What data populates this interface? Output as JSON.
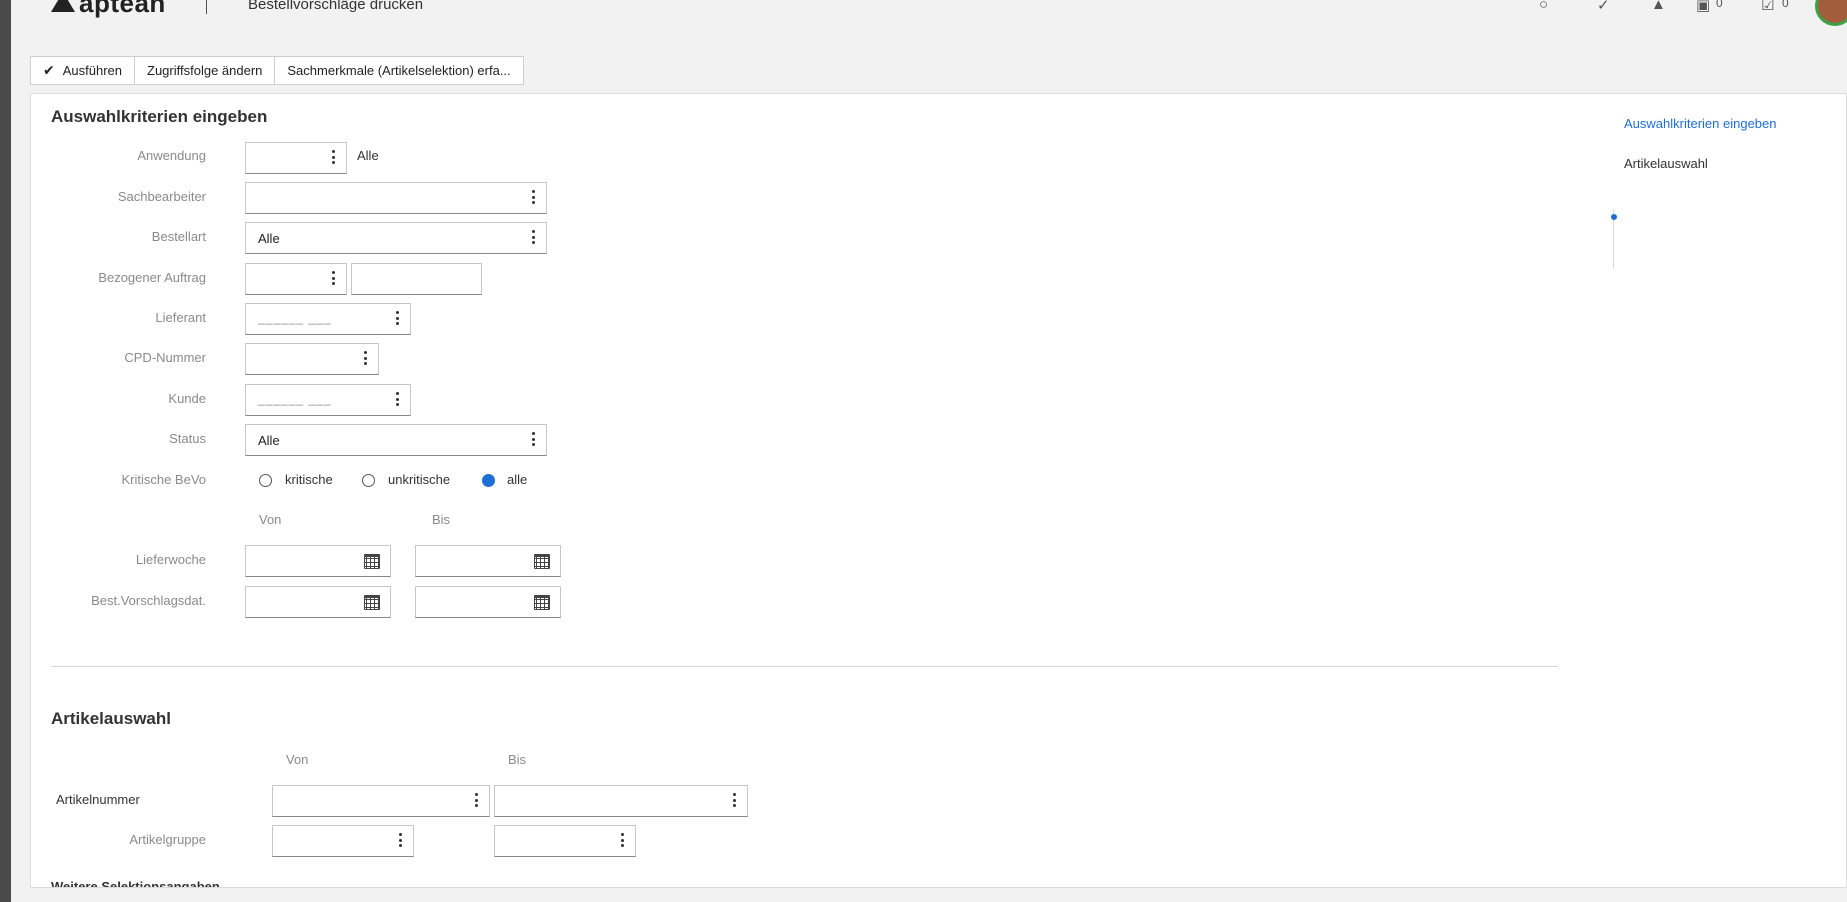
{
  "header": {
    "logo": "aptean",
    "page_title": "Bestellvorschläge drucken",
    "count_1": "0",
    "count_2": "0"
  },
  "toolbar": {
    "execute_label": "Ausführen",
    "change_sequence_label": "Zugriffsfolge ändern",
    "features_label": "Sachmerkmale (Artikelselektion) erfa..."
  },
  "section1": {
    "title": "Auswahlkriterien eingeben",
    "anwendung_label": "Anwendung",
    "anwendung_suffix": "Alle",
    "sachbearbeiter_label": "Sachbearbeiter",
    "bestellart_label": "Bestellart",
    "bestellart_value": "Alle",
    "bezogener_auftrag_label": "Bezogener Auftrag",
    "lieferant_label": "Lieferant",
    "lieferant_mask": "______ ___",
    "cpd_label": "CPD-Nummer",
    "kunde_label": "Kunde",
    "kunde_mask": "______ ___",
    "status_label": "Status",
    "status_value": "Alle",
    "kritische_label": "Kritische BeVo",
    "radio_kritische": "kritische",
    "radio_unkritische": "unkritische",
    "radio_alle": "alle",
    "von": "Von",
    "bis": "Bis",
    "lieferwoche_label": "Lieferwoche",
    "bestvorschlagsdat_label": "Best.Vorschlagsdat."
  },
  "section2": {
    "title": "Artikelauswahl",
    "von": "Von",
    "bis": "Bis",
    "artikelnummer_label": "Artikelnummer",
    "artikelgruppe_label": "Artikelgruppe",
    "weitere_label": "Weitere Selektionsangaben"
  },
  "nav": {
    "item1": "Auswahlkriterien eingeben",
    "item2": "Artikelauswahl"
  },
  "colors": {
    "accent": "#1f6ed4",
    "avatar_ring": "#3aa346"
  }
}
